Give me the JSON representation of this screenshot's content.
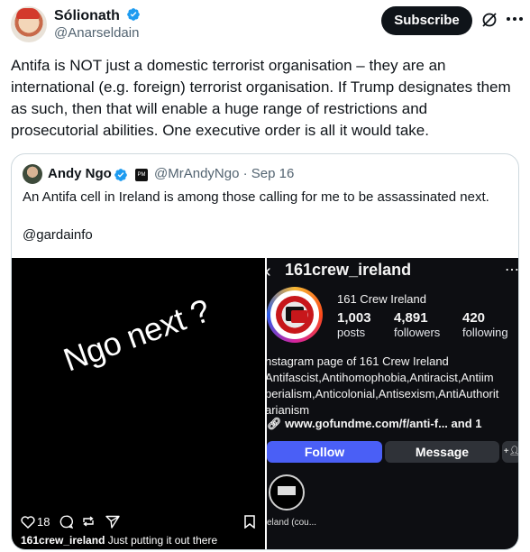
{
  "tweet": {
    "author_name": "Sólionath",
    "author_handle": "@Anarseldain",
    "subscribe_label": "Subscribe",
    "text": "Antifa is NOT just a domestic terrorist organisation – they are an international (e.g. foreign) terrorist organisation. If Trump designates them as such, then that will enable a huge range of restrictions and prosecutorial abilities. One executive order is all it would take.",
    "icons": [
      "verified-badge-icon",
      "grok-icon",
      "more-icon"
    ],
    "colors": {
      "verified": "#1d9bf0",
      "text": "#0f1419",
      "secondary": "#536471"
    }
  },
  "quote": {
    "author_name": "Andy Ngo",
    "org_badge": "PM",
    "author_handle_date": "@MrAndyNgo · Sep 16",
    "text": "An Antifa cell in Ireland is among those calling for me to be assassinated next.",
    "mention": "@gardainfo",
    "story": {
      "overlay_text": "Ngo next ?",
      "like_count": "18",
      "caption_user": "161crew_ireland",
      "caption_text": " Just putting it out there"
    },
    "profile": {
      "username": "161crew_ireland",
      "display_name": "161 Crew Ireland",
      "posts_count": "1,003",
      "posts_label": "posts",
      "followers_count": "4,891",
      "followers_label": "followers",
      "following_count": "420",
      "following_label": "following",
      "bio_line1": "nstagram page of 161 Crew Ireland",
      "bio_line2": "Antifascist,Antihomophobia,Antiracist,Antiim",
      "bio_line3": "perialism,Anticolonial,Antisexism,AntiAuthorit",
      "bio_line4": "arianism",
      "link_text": "www.gofundme.com/f/anti-f...  and 1",
      "follow_label": "Follow",
      "message_label": "Message",
      "highlight_label": "eland (cou..."
    }
  }
}
